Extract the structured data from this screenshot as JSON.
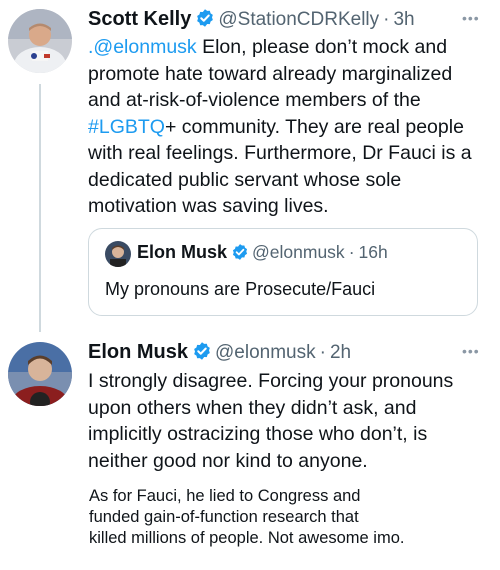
{
  "tweet1": {
    "name": "Scott Kelly",
    "handle": "@StationCDRKelly",
    "sep": "·",
    "time": "3h",
    "more": "•••",
    "mention": ".@elonmusk",
    "text_a": " Elon, please don’t mock and promote hate toward already marginalized and at-risk-of-violence members of the ",
    "hashtag": "#LGBTQ",
    "text_b": "+ community. They are real people with real feelings. Furthermore, Dr Fauci is a dedicated public servant whose sole motivation was saving lives."
  },
  "quote": {
    "name": "Elon Musk",
    "handle": "@elonmusk",
    "sep": "·",
    "time": "16h",
    "text": "My pronouns are Prosecute/Fauci"
  },
  "tweet2": {
    "name": "Elon Musk",
    "handle": "@elonmusk",
    "sep": "·",
    "time": "2h",
    "more": "•••",
    "text": "I strongly disagree. Forcing your pronouns upon others when they didn’t ask, and implicitly ostracizing those who don’t, is neither good nor kind to anyone."
  },
  "overlay": {
    "line1": "As for Fauci, he lied to Congress and",
    "line2": "funded gain-of-function research that",
    "line3": "killed millions of people. Not awesome imo."
  },
  "colors": {
    "verified": "#1d9bf0",
    "link": "#1d9bf0",
    "secondary": "#536471"
  }
}
